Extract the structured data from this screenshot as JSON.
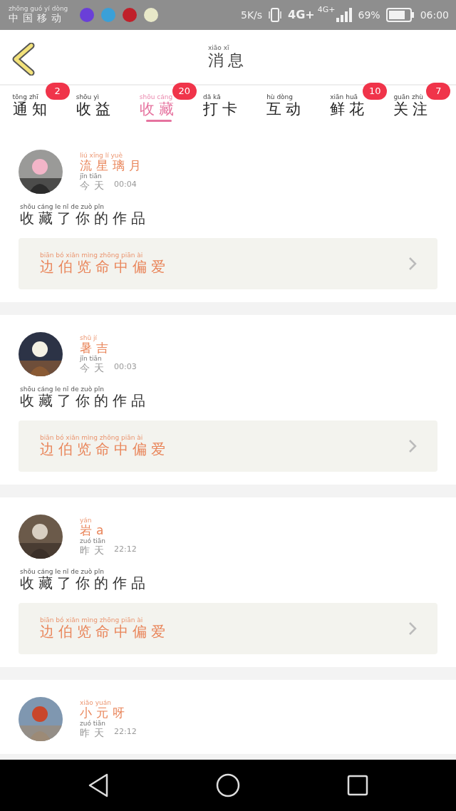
{
  "status_bar": {
    "carrier": {
      "text": "中国移动",
      "pinyin": [
        "zhōng",
        "guó",
        "yí",
        "dòng"
      ]
    },
    "speed": "5K/s",
    "network_1": "4G+",
    "network_2": "4G+",
    "battery": "69%",
    "time": "06:00"
  },
  "header": {
    "title": {
      "text": "消息",
      "pinyin": [
        "xiāo",
        "xī"
      ]
    }
  },
  "tabs": [
    {
      "label": {
        "text": "通知",
        "pinyin": [
          "tōng",
          "zhī"
        ]
      },
      "badge": "2",
      "selected": false
    },
    {
      "label": {
        "text": "收益",
        "pinyin": [
          "shōu",
          "yì"
        ]
      },
      "selected": false
    },
    {
      "label": {
        "text": "收藏",
        "pinyin": [
          "shōu",
          "cáng"
        ]
      },
      "badge": "20",
      "selected": true
    },
    {
      "label": {
        "text": "打卡",
        "pinyin": [
          "dǎ",
          "kǎ"
        ]
      },
      "selected": false
    },
    {
      "label": {
        "text": "互动",
        "pinyin": [
          "hù",
          "dòng"
        ]
      },
      "selected": false
    },
    {
      "label": {
        "text": "鲜花",
        "pinyin": [
          "xiān",
          "huā"
        ]
      },
      "badge": "10",
      "selected": false
    },
    {
      "label": {
        "text": "关注",
        "pinyin": [
          "guān",
          "zhù"
        ]
      },
      "badge": "7",
      "selected": false
    }
  ],
  "messages": [
    {
      "name": {
        "text": "流星璃月",
        "pinyin": [
          "liú",
          "xīng",
          "lí",
          "yuè"
        ]
      },
      "day": {
        "text": "今天",
        "pinyin": [
          "jīn",
          "tiān"
        ]
      },
      "time": "00:04",
      "action": {
        "text": "收藏了你的作品",
        "pinyin": [
          "shōu",
          "cáng",
          "le",
          "nǐ",
          "de",
          "zuò",
          "pǐn"
        ]
      },
      "work": {
        "text": "边伯览命中偏爱",
        "pinyin": [
          "biān",
          "bó",
          "xiǎn",
          "mìng",
          "zhōng",
          "piān",
          "ài"
        ]
      }
    },
    {
      "name": {
        "text": "暑吉",
        "pinyin": [
          "shǔ",
          "jí"
        ]
      },
      "day": {
        "text": "今天",
        "pinyin": [
          "jīn",
          "tiān"
        ]
      },
      "time": "00:03",
      "action": {
        "text": "收藏了你的作品",
        "pinyin": [
          "shōu",
          "cáng",
          "le",
          "nǐ",
          "de",
          "zuò",
          "pǐn"
        ]
      },
      "work": {
        "text": "边伯览命中偏爱",
        "pinyin": [
          "biān",
          "bó",
          "xiǎn",
          "mìng",
          "zhōng",
          "piān",
          "ài"
        ]
      }
    },
    {
      "name": {
        "text": "岩a",
        "pinyin": [
          "yán"
        ]
      },
      "day": {
        "text": "昨天",
        "pinyin": [
          "zuó",
          "tiān"
        ]
      },
      "time": "22:12",
      "action": {
        "text": "收藏了你的作品",
        "pinyin": [
          "shōu",
          "cáng",
          "le",
          "nǐ",
          "de",
          "zuò",
          "pǐn"
        ]
      },
      "work": {
        "text": "边伯览命中偏爱",
        "pinyin": [
          "biān",
          "bó",
          "xiǎn",
          "mìng",
          "zhōng",
          "piān",
          "ài"
        ]
      }
    },
    {
      "name": {
        "text": "小元呀",
        "pinyin": [
          "xiǎo",
          "yuán"
        ]
      },
      "day": {
        "text": "昨天",
        "pinyin": [
          "zuó",
          "tiān"
        ]
      },
      "time": "22:12"
    }
  ]
}
